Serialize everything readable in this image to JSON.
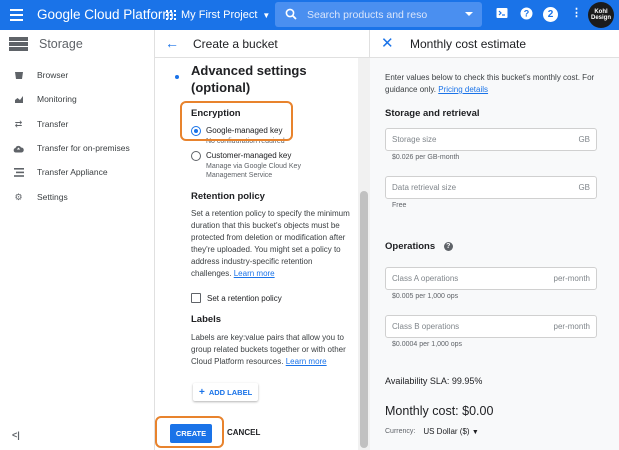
{
  "topbar": {
    "app_title": "Google Cloud Platform",
    "project": "My First Project",
    "search_placeholder": "Search products and reso",
    "badge_count": "2",
    "avatar_text": "Kohl Design",
    "colors": {
      "bar": "#1a73e8",
      "accent": "#1a73e8",
      "highlight": "#e8832d"
    }
  },
  "sidebar": {
    "title": "Storage",
    "items": [
      {
        "label": "Browser",
        "icon": "bucket-icon"
      },
      {
        "label": "Monitoring",
        "icon": "chart-icon"
      },
      {
        "label": "Transfer",
        "icon": "transfer-arrows-icon"
      },
      {
        "label": "Transfer for on-premises",
        "icon": "cloud-upload-icon"
      },
      {
        "label": "Transfer Appliance",
        "icon": "list-icon"
      },
      {
        "label": "Settings",
        "icon": "gear-icon"
      }
    ],
    "collapse_label": "<|"
  },
  "create_panel": {
    "title": "Create a bucket",
    "advanced_title_line1": "Advanced settings",
    "advanced_title_line2": "(optional)",
    "encryption": {
      "title": "Encryption",
      "google_managed": "Google-managed key",
      "google_managed_sub": "No configuration required",
      "customer_managed": "Customer-managed key",
      "customer_managed_sub_1": "Manage via Google Cloud Key",
      "customer_managed_sub_2": "Management Service",
      "selected": "google_managed"
    },
    "retention": {
      "title": "Retention policy",
      "description": "Set a retention policy to specify the minimum duration that this bucket's objects must be protected from deletion or modification after they're uploaded. You might set a policy to address industry-specific retention challenges.",
      "learn_more": "Learn more",
      "checkbox_label": "Set a retention policy",
      "checked": false
    },
    "labels": {
      "title": "Labels",
      "description": "Labels are key:value pairs that allow you to group related buckets together or with other Cloud Platform resources.",
      "learn_more": "Learn more",
      "add_label": "ADD LABEL"
    },
    "create_button": "CREATE",
    "cancel_button": "CANCEL"
  },
  "cost_panel": {
    "title": "Monthly cost estimate",
    "intro": "Enter values below to check this bucket's monthly cost. For guidance only.",
    "pricing_link": "Pricing details",
    "storage_title": "Storage and retrieval",
    "storage_size": {
      "placeholder": "Storage size",
      "unit": "GB",
      "hint": "$0.026 per GB-month"
    },
    "retrieval_size": {
      "placeholder": "Data retrieval size",
      "unit": "GB",
      "hint": "Free"
    },
    "operations_title": "Operations",
    "class_a": {
      "placeholder": "Class A operations",
      "unit": "per-month",
      "hint": "$0.005 per 1,000 ops"
    },
    "class_b": {
      "placeholder": "Class B operations",
      "unit": "per-month",
      "hint": "$0.0004 per 1,000 ops"
    },
    "sla": "Availability SLA: 99.95%",
    "monthly_cost": "Monthly cost: $0.00",
    "currency_label": "Currency:",
    "currency_value": "US Dollar ($)"
  }
}
